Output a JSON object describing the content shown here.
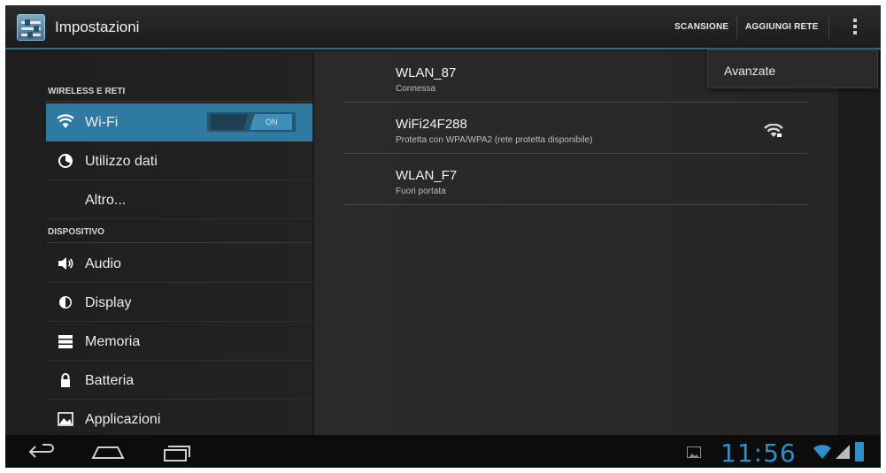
{
  "actionbar": {
    "title": "Impostazioni",
    "scan_label": "SCANSIONE",
    "add_network_label": "AGGIUNGI RETE"
  },
  "overflow_menu": {
    "items": [
      {
        "label": "Avanzate"
      }
    ]
  },
  "sidebar": {
    "sections": [
      {
        "header": "WIRELESS E RETI"
      },
      {
        "header": "DISPOSITIVO"
      }
    ],
    "items": [
      {
        "label": "Wi-Fi",
        "icon": "wifi-icon",
        "selected": true
      },
      {
        "label": "Utilizzo dati",
        "icon": "data-usage-icon"
      },
      {
        "label": "Altro..."
      },
      {
        "label": "Audio",
        "icon": "speaker-icon"
      },
      {
        "label": "Display",
        "icon": "brightness-icon"
      },
      {
        "label": "Memoria",
        "icon": "storage-icon"
      },
      {
        "label": "Batteria",
        "icon": "battery-lock-icon"
      },
      {
        "label": "Applicazioni",
        "icon": "apps-icon"
      }
    ],
    "wifi_toggle": {
      "state": "ON"
    }
  },
  "networks": [
    {
      "ssid": "WLAN_87",
      "summary": "Connessa"
    },
    {
      "ssid": "WiFi24F288",
      "summary": "Protetta con WPA/WPA2 (rete protetta disponibile)",
      "signal_icon": "wifi-signal-locked-icon"
    },
    {
      "ssid": "WLAN_F7",
      "summary": "Fuori portata"
    }
  ],
  "systembar": {
    "time": "11:56",
    "accent_color": "#2f8fc9"
  }
}
